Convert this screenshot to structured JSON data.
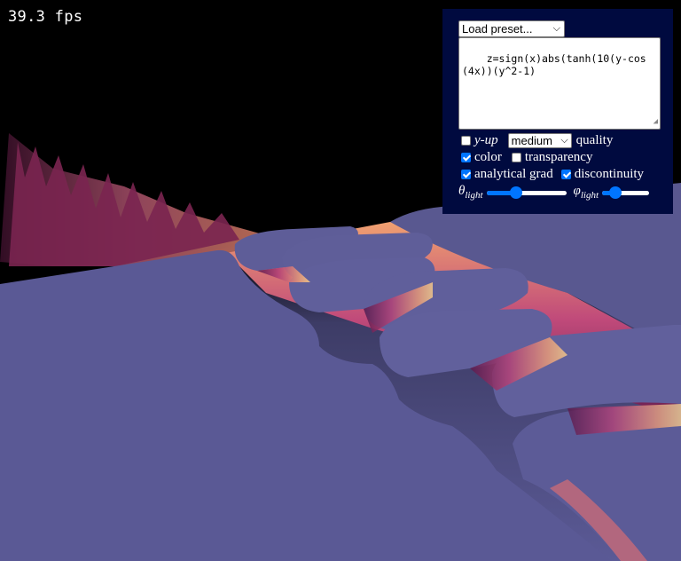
{
  "fps_label": "39.3 fps",
  "preset": {
    "label": "Load preset..."
  },
  "expression": "z=sign(x)abs(tanh(10(y-cos(4x))(y^2-1)",
  "options": {
    "y_up": {
      "label": "y-up",
      "checked": false
    },
    "quality": {
      "selected": "medium",
      "label": "quality"
    },
    "color": {
      "label": "color",
      "checked": true
    },
    "transparency": {
      "label": "transparency",
      "checked": false
    },
    "analytical_grad": {
      "label": "analytical grad",
      "checked": true
    },
    "discontinuity": {
      "label": "discontinuity",
      "checked": true
    }
  },
  "sliders": {
    "theta": {
      "symbol": "θ",
      "sub": "light",
      "value": 0.37
    },
    "phi": {
      "symbol": "φ",
      "sub": "light",
      "value": 0.28
    }
  },
  "colors": {
    "surface": "#5b5a96",
    "accent": "#0075ff",
    "panel": "#000a3f"
  }
}
